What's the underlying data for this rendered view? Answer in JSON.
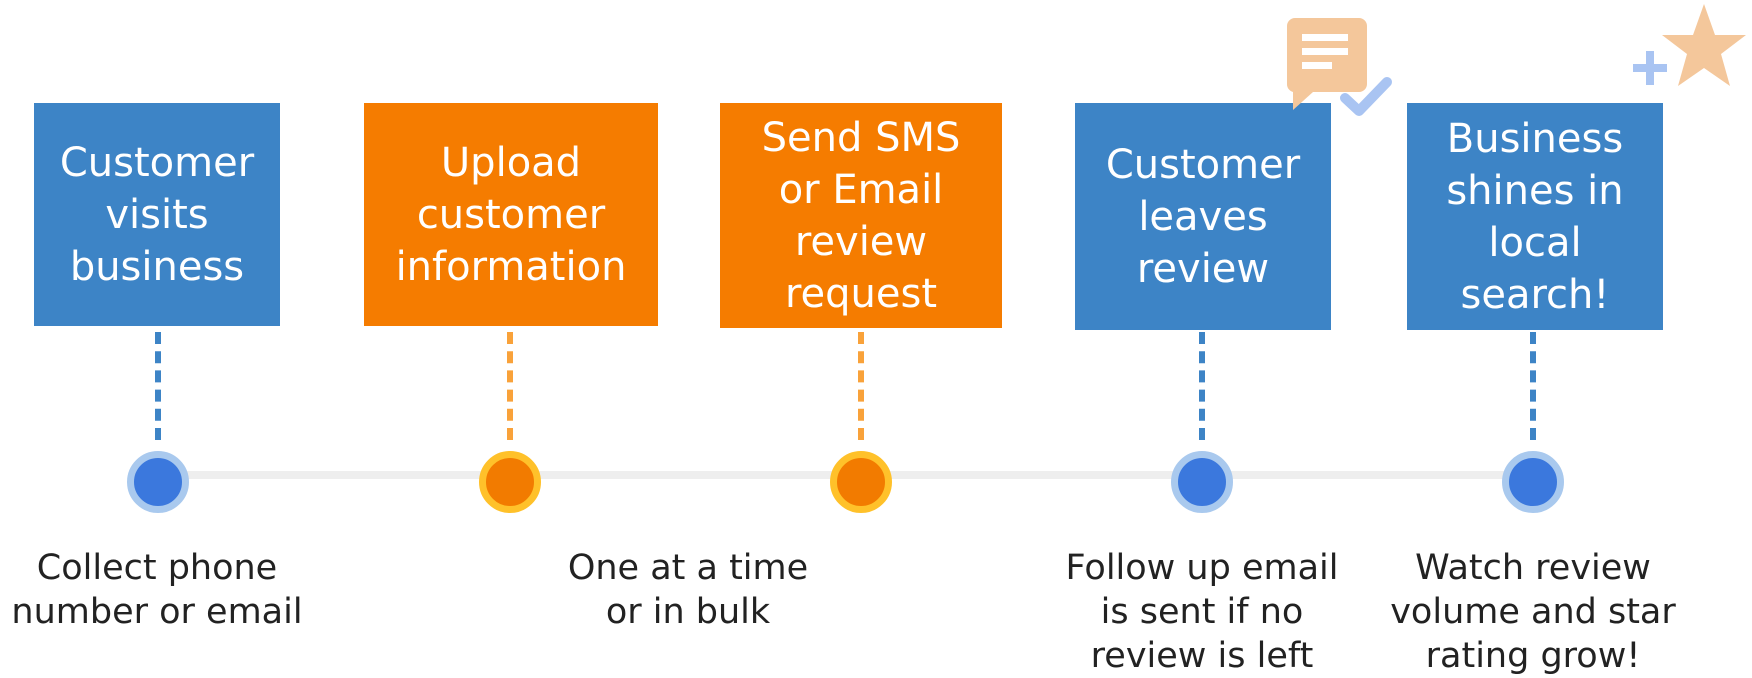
{
  "steps": [
    {
      "label": "Customer\nvisits\nbusiness",
      "caption": "Collect phone\nnumber or email",
      "color": "blue"
    },
    {
      "label": "Upload\ncustomer\ninformation",
      "caption": "",
      "color": "orange"
    },
    {
      "label": "Send SMS\nor Email\nreview\nrequest",
      "caption": "",
      "color": "orange"
    },
    {
      "label": "Customer\nleaves\nreview",
      "caption": "Follow up email\nis sent if no\nreview is left",
      "color": "blue"
    },
    {
      "label": "Business\nshines in\nlocal\nsearch!",
      "caption": "Watch review\nvolume and star\nrating grow!",
      "color": "blue"
    }
  ],
  "shared_caption": "One at a time\nor in bulk",
  "colors": {
    "blue": "#3d84c6",
    "orange": "#f57c00",
    "blue_dash": "#3d84c6",
    "orange_dash": "#f9a23a",
    "timeline": "#eeeeee",
    "icon_peach": "#f4c79b",
    "icon_blue": "#a9c4f2"
  },
  "icons": [
    "chat-check-icon",
    "plus-star-icon"
  ]
}
